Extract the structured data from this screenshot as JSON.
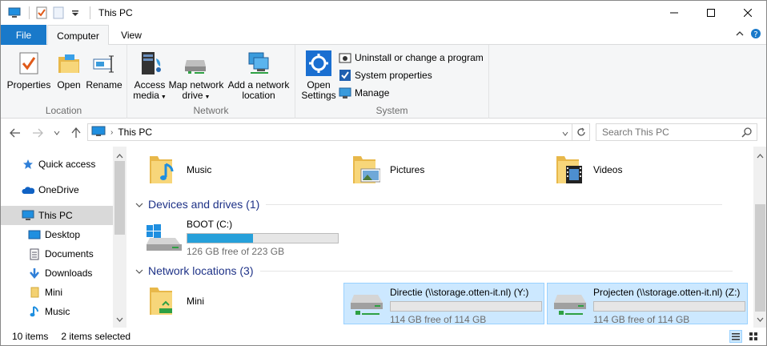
{
  "window": {
    "title": "This PC"
  },
  "tabs": {
    "file": "File",
    "computer": "Computer",
    "view": "View"
  },
  "ribbon": {
    "location": {
      "caption": "Location",
      "properties": "Properties",
      "open": "Open",
      "rename": "Rename"
    },
    "network": {
      "caption": "Network",
      "access_media_1": "Access",
      "access_media_2": "media",
      "map_drive_1": "Map network",
      "map_drive_2": "drive",
      "add_loc_1": "Add a network",
      "add_loc_2": "location"
    },
    "system": {
      "caption": "System",
      "open_settings_1": "Open",
      "open_settings_2": "Settings",
      "uninstall": "Uninstall or change a program",
      "sysprops": "System properties",
      "manage": "Manage"
    }
  },
  "address": {
    "crumb": "This PC",
    "search_placeholder": "Search This PC"
  },
  "nav": {
    "items": [
      "Quick access",
      "OneDrive",
      "This PC",
      "Desktop",
      "Documents",
      "Downloads",
      "Mini",
      "Music"
    ]
  },
  "content": {
    "folders": [
      "Music",
      "Pictures",
      "Videos"
    ],
    "devices_header": "Devices and drives (1)",
    "drive": {
      "name": "BOOT (C:)",
      "free": "126 GB free of 223 GB",
      "used_fraction": 0.435
    },
    "network_header": "Network locations (3)",
    "netfolder": "Mini",
    "netdrives": [
      {
        "name": "Directie (\\\\storage.otten-it.nl) (Y:)",
        "free": "114 GB free of 114 GB",
        "used_fraction": 0.0
      },
      {
        "name": "Projecten (\\\\storage.otten-it.nl) (Z:)",
        "free": "114 GB free of 114 GB",
        "used_fraction": 0.0
      }
    ]
  },
  "status": {
    "items": "10 items",
    "selected": "2 items selected"
  },
  "colors": {
    "file_tab": "#1979ca",
    "selection": "#cce8ff",
    "drive_bar": "#26a0da",
    "section_header": "#1e3287"
  }
}
